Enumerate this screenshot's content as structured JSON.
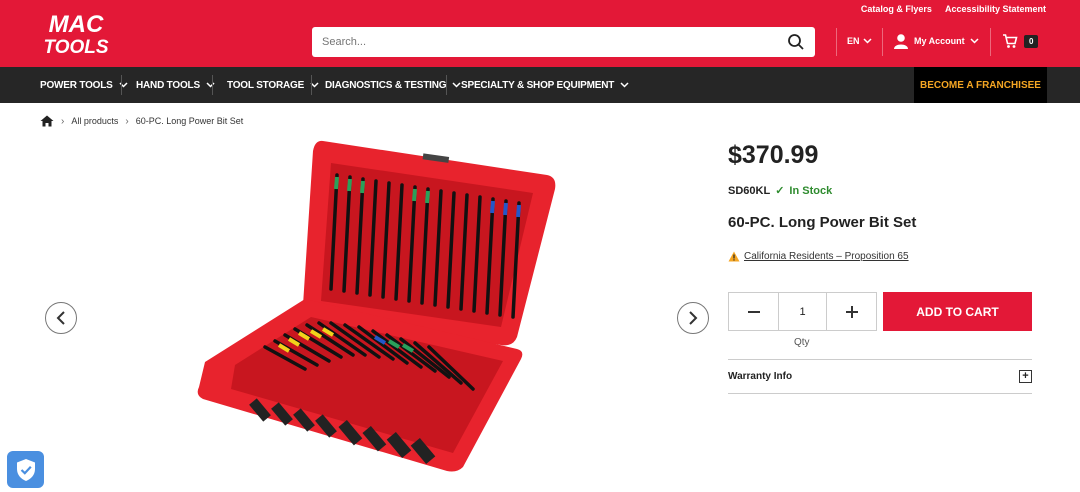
{
  "header": {
    "logo_text": "MAC TOOLS",
    "links": [
      "Catalog & Flyers",
      "Accessibility Statement"
    ],
    "search_placeholder": "Search...",
    "language": "EN",
    "account_label": "My Account",
    "cart_count": "0",
    "brand_color": "#e31837"
  },
  "nav": {
    "items": [
      "POWER TOOLS",
      "HAND TOOLS",
      "TOOL STORAGE",
      "DIAGNOSTICS & TESTING",
      "SPECIALTY & SHOP EQUIPMENT"
    ],
    "franchise": "BECOME A FRANCHISEE"
  },
  "breadcrumb": {
    "items": [
      "All products",
      "60-PC. Long Power Bit Set"
    ]
  },
  "product": {
    "price": "$370.99",
    "sku": "SD60KL",
    "stock": "In Stock",
    "name": "60-PC. Long Power Bit Set",
    "prop65": "California Residents – Proposition 65",
    "qty": "1",
    "qty_label": "Qty",
    "add_to_cart": "ADD TO CART",
    "warranty": "Warranty Info"
  }
}
